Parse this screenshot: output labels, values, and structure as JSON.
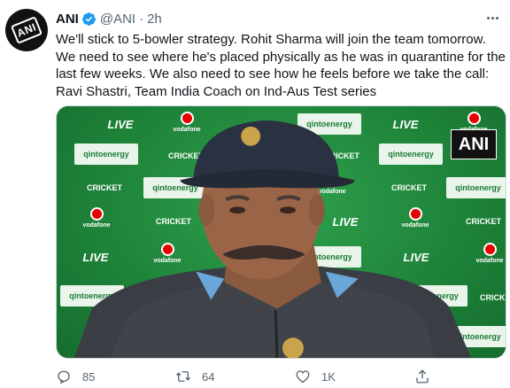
{
  "tweet": {
    "author_name": "ANI",
    "handle": "@ANI",
    "separator": "·",
    "time": "2h",
    "text_lines": [
      "We'll stick to 5-bowler strategy. Rohit Sharma will join the team tomorrow.",
      "We need to see where he's placed physically as he was in quarantine for the",
      "last few weeks. We also need to see how he feels before we take the call:",
      "Ravi Shastri, Team India Coach on Ind-Aus Test series"
    ],
    "avatar_text": "ANI",
    "icons": {
      "verified": "verified-badge-icon",
      "more": "more-options-icon",
      "reply": "reply-icon",
      "retweet": "retweet-icon",
      "like": "like-icon",
      "share": "share-icon"
    }
  },
  "media": {
    "watermark": "ANI",
    "backdrop": {
      "live_label": "LIVE",
      "cricket_label": "CRICKET",
      "vodafone_label": "vodafone",
      "qintoenergy_label": "qintoenergy"
    }
  },
  "actions": {
    "replies": "85",
    "retweets": "64",
    "likes": "1K"
  },
  "colors": {
    "text": "#0f1419",
    "secondary": "#536471",
    "verified": "#1d9bf0",
    "backdrop_green": "#1f8a3a"
  }
}
